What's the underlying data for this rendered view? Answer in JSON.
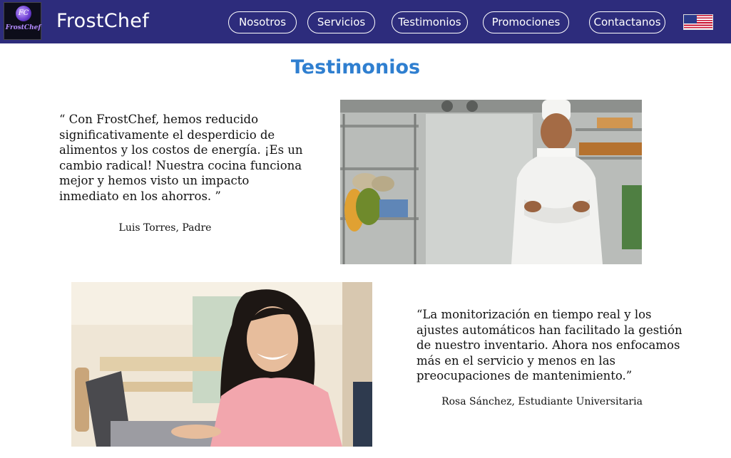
{
  "header": {
    "brand": "FrostChef",
    "logo_text": "FrostChef",
    "logo_monogram": "FC",
    "nav": [
      "Nosotros",
      "Servicios",
      "Testimonios",
      "Promociones",
      "Contactanos"
    ],
    "language_icon": "us-flag-icon"
  },
  "section": {
    "title": "Testimonios"
  },
  "testimonials": [
    {
      "quote_lines": [
        "“ Con FrostChef, hemos reducido",
        "significativamente el desperdicio de",
        "alimentos y los costos de energía. ¡Es un",
        "cambio radical! Nuestra cocina funciona",
        "mejor y hemos visto un impacto",
        "inmediato en los ahorros. ”"
      ],
      "author": "Luis Torres, Padre",
      "photo_icon": "chef-photo"
    },
    {
      "quote_lines": [
        "“La monitorización en tiempo real y los",
        "ajustes automáticos han facilitado la gestión",
        "de nuestro inventario. Ahora nos enfocamos",
        "más en el servicio y menos en las",
        "preocupaciones de mantenimiento.”"
      ],
      "author": "Rosa Sánchez, Estudiante Universitaria",
      "photo_icon": "student-photo"
    }
  ],
  "colors": {
    "header_bg": "#2d2c7c",
    "title": "#2f7fd0",
    "text": "#111111"
  }
}
